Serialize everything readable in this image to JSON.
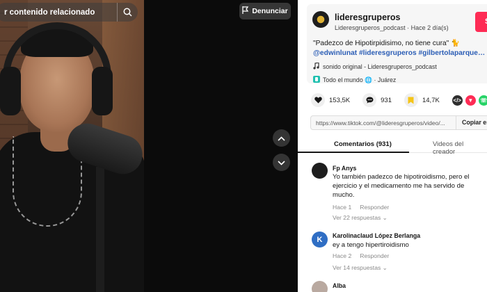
{
  "video": {
    "search_text": "r contenido relacionado",
    "report_label": "Denunciar"
  },
  "post": {
    "username": "lideresgruperos",
    "meta": "Lideresgruperos_podcast · Hace 2 día(s)",
    "follow_label": "Seg",
    "caption_text": "\"Padezco de Hipotirpidisimo, no tiene cura\" 🐈",
    "caption_tags": "@edwinlunat #lideresgruperos #gilbertolaparque…",
    "sound": "sonido original - Lideresgruperos_podcast",
    "location": "Todo el mundo 🌐 · Juárez",
    "stats": {
      "likes": "153,5K",
      "comments": "931",
      "saves": "14,7K"
    },
    "share_icons": [
      "embed-icon",
      "pinterest-icon",
      "whatsapp-icon",
      "facebook-icon"
    ],
    "url": "https://www.tiktok.com/@lideresgruperos/video/...",
    "copy_label": "Copiar en"
  },
  "tabs": {
    "comments": "Comentarios (931)",
    "creator": "Videos del creador"
  },
  "comments": [
    {
      "author": "Fp Anys",
      "text": "Yo también padezco de hipotiroidismo, pero el ejercicio y el medicamento me ha servido de mucho.",
      "time": "Hace 1",
      "reply": "Responder",
      "replies": "Ver 22 respuestas ⌄",
      "avatar_color": "#1e1e1e"
    },
    {
      "author": "Karolinaclaud López Berlanga",
      "text": "ey a tengo hipertiroidismo",
      "time": "Hace 2",
      "reply": "Responder",
      "replies": "Ver 14 respuestas ⌄",
      "avatar_color": "#2f6ec4",
      "avatar_letter": "K"
    },
    {
      "author": "Alba",
      "avatar_color": "#b9a9a0"
    }
  ],
  "colors": {
    "accent": "#fe2c55",
    "link": "#2b5db5"
  }
}
